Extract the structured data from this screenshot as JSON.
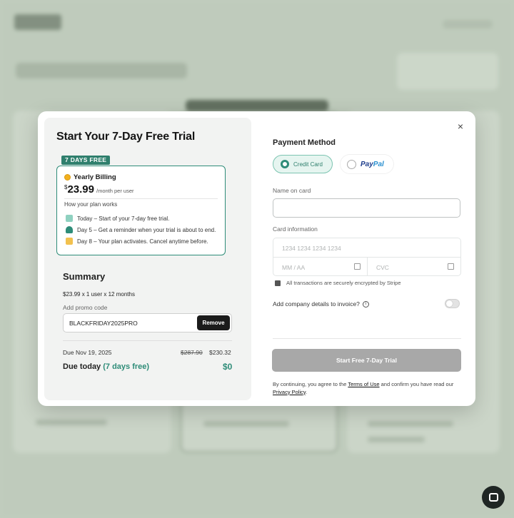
{
  "modal": {
    "title": "Start Your 7-Day Free Trial",
    "close_glyph": "×"
  },
  "plan": {
    "badge": "7 DAYS FREE",
    "billing_label": "Yearly Billing",
    "currency": "$",
    "price": "23.99",
    "period": "/month per user",
    "how_label": "How your plan works",
    "steps": [
      {
        "icon": "gift-icon",
        "text": "Today – Start of your 7-day free trial."
      },
      {
        "icon": "bell-icon",
        "text": "Day 5 – Get a reminder when your trial is about to end."
      },
      {
        "icon": "crown-icon",
        "text": "Day 8 – Your plan activates. Cancel anytime before."
      }
    ]
  },
  "summary": {
    "title": "Summary",
    "line": "$23.99 x 1 user x 12 months",
    "promo_label": "Add promo code",
    "promo_value": "BLACKFRIDAY2025PRO",
    "remove_label": "Remove",
    "due_label": "Due Nov 19, 2025",
    "old_price": "$287.90",
    "new_price": "$230.32",
    "due_today_label": "Due today",
    "due_today_free": "(7 days free)",
    "due_today_amount": "$0"
  },
  "payment": {
    "title": "Payment Method",
    "credit_card_label": "Credit Card",
    "paypal_a": "Pay",
    "paypal_b": "Pal",
    "selected": "Credit Card",
    "name_label": "Name on card",
    "name_value": "",
    "card_info_label": "Card information",
    "card_number_placeholder": "1234 1234 1234 1234",
    "expiry_placeholder": "MM / AA",
    "cvc_placeholder": "CVC",
    "secure_note": "All transactions are securely encrypted by Stripe",
    "company_label": "Add company details to invoice?",
    "company_toggle": false,
    "cta_label": "Start Free 7-Day Trial",
    "terms_prefix": "By continuing, you agree to the",
    "terms_link": "Terms of Use",
    "terms_middle": "and confirm you have read our",
    "privacy_link": "Privacy Policy",
    "terms_suffix": "."
  },
  "colors": {
    "accent": "#2e8c78",
    "cta_disabled": "#a8a8a8",
    "badge": "#2f7f6d"
  }
}
